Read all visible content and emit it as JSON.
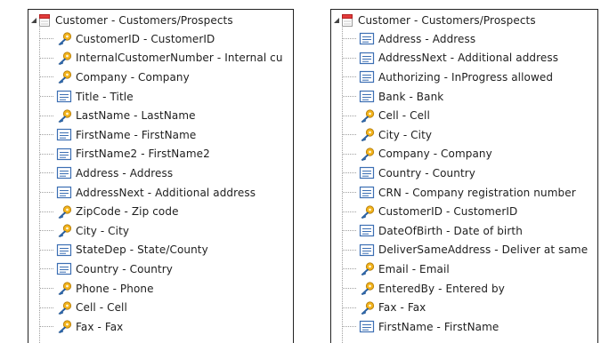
{
  "left": {
    "root_label": "Customer  -  Customers/Prospects",
    "items": [
      {
        "icon": "key-icon",
        "label": "CustomerID  -  CustomerID"
      },
      {
        "icon": "key-icon",
        "label": "InternalCustomerNumber  -  Internal cu"
      },
      {
        "icon": "key-icon",
        "label": "Company  -  Company"
      },
      {
        "icon": "field-icon",
        "label": "Title  -  Title"
      },
      {
        "icon": "key-icon",
        "label": "LastName  -  LastName"
      },
      {
        "icon": "field-icon",
        "label": "FirstName  -  FirstName"
      },
      {
        "icon": "field-icon",
        "label": "FirstName2  -  FirstName2"
      },
      {
        "icon": "field-icon",
        "label": "Address  -  Address"
      },
      {
        "icon": "field-icon",
        "label": "AddressNext  -  Additional address"
      },
      {
        "icon": "key-icon",
        "label": "ZipCode  -  Zip code"
      },
      {
        "icon": "key-icon",
        "label": "City  -  City"
      },
      {
        "icon": "field-icon",
        "label": "StateDep  -  State/County"
      },
      {
        "icon": "field-icon",
        "label": "Country  -  Country"
      },
      {
        "icon": "key-icon",
        "label": "Phone  -  Phone"
      },
      {
        "icon": "key-icon",
        "label": "Cell  -  Cell"
      },
      {
        "icon": "key-icon",
        "label": "Fax  -  Fax"
      }
    ]
  },
  "right": {
    "root_label": "Customer  -  Customers/Prospects",
    "items": [
      {
        "icon": "field-icon",
        "label": "Address  -  Address"
      },
      {
        "icon": "field-icon",
        "label": "AddressNext  -  Additional address"
      },
      {
        "icon": "field-icon",
        "label": "Authorizing  -  InProgress allowed"
      },
      {
        "icon": "field-icon",
        "label": "Bank  -  Bank"
      },
      {
        "icon": "key-icon",
        "label": "Cell  -  Cell"
      },
      {
        "icon": "key-icon",
        "label": "City  -  City"
      },
      {
        "icon": "key-icon",
        "label": "Company  -  Company"
      },
      {
        "icon": "field-icon",
        "label": "Country  -  Country"
      },
      {
        "icon": "field-icon",
        "label": "CRN  -  Company registration number"
      },
      {
        "icon": "key-icon",
        "label": "CustomerID  -  CustomerID"
      },
      {
        "icon": "field-icon",
        "label": "DateOfBirth  -  Date of birth"
      },
      {
        "icon": "field-icon",
        "label": "DeliverSameAddress  -  Deliver at same"
      },
      {
        "icon": "key-icon",
        "label": "Email  -  Email"
      },
      {
        "icon": "key-icon",
        "label": "EnteredBy  -  Entered by"
      },
      {
        "icon": "key-icon",
        "label": "Fax  -  Fax"
      },
      {
        "icon": "field-icon",
        "label": "FirstName  -  FirstName"
      }
    ]
  }
}
